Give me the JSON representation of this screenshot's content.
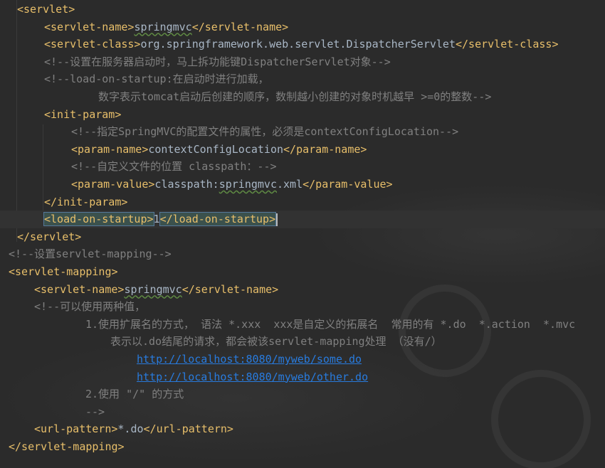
{
  "editor": {
    "lines": [
      {
        "segments": [
          {
            "text": "<servlet>",
            "kind": "tag"
          }
        ]
      },
      {
        "segments": [
          {
            "text": "<servlet-name>",
            "kind": "tag"
          },
          {
            "text": "springmvc",
            "kind": "text",
            "squiggle": true
          },
          {
            "text": "</servlet-name>",
            "kind": "tag"
          }
        ]
      },
      {
        "segments": [
          {
            "text": "<servlet-class>",
            "kind": "tag"
          },
          {
            "text": "org.springframework.web.servlet.DispatcherServlet",
            "kind": "text"
          },
          {
            "text": "</servlet-class>",
            "kind": "tag"
          }
        ]
      },
      {
        "segments": [
          {
            "text": "<!--设置在服务器启动时，马上拆功能键DispatcherServlet对象-->",
            "kind": "comment"
          }
        ]
      },
      {
        "segments": [
          {
            "text": "<!--load-on-startup:在启动时进行加载，",
            "kind": "comment"
          }
        ]
      },
      {
        "segments": [
          {
            "text": "数字表示tomcat启动后创建的顺序，数制越小创建的对象时机越早 >=0的整数-->",
            "kind": "comment"
          }
        ]
      },
      {
        "segments": [
          {
            "text": "<init-param>",
            "kind": "tag"
          }
        ]
      },
      {
        "segments": [
          {
            "text": "<!--指定SpringMVC的配置文件的属性，必须是contextConfigLocation-->",
            "kind": "comment"
          }
        ]
      },
      {
        "segments": [
          {
            "text": "<param-name>",
            "kind": "tag"
          },
          {
            "text": "contextConfigLocation",
            "kind": "text"
          },
          {
            "text": "</param-name>",
            "kind": "tag"
          }
        ]
      },
      {
        "segments": [
          {
            "text": "<!--自定义文件的位置 classpath：-->",
            "kind": "comment"
          }
        ]
      },
      {
        "segments": [
          {
            "text": "<param-value>",
            "kind": "tag"
          },
          {
            "text": "classpath:",
            "kind": "text"
          },
          {
            "text": "springmvc",
            "kind": "text",
            "squiggle": true
          },
          {
            "text": ".xml",
            "kind": "text"
          },
          {
            "text": "</param-value>",
            "kind": "tag"
          }
        ]
      },
      {
        "segments": [
          {
            "text": "</init-param>",
            "kind": "tag"
          }
        ]
      },
      {
        "segments": [
          {
            "text": "<load-on-startup>",
            "kind": "tag",
            "highlight": true
          },
          {
            "text": "1",
            "kind": "text"
          },
          {
            "text": "</load-on-startup>",
            "kind": "tag",
            "highlight": true
          }
        ],
        "current": true
      },
      {
        "segments": [
          {
            "text": "</servlet>",
            "kind": "tag"
          }
        ]
      },
      {
        "segments": [
          {
            "text": "<!--设置servlet-mapping-->",
            "kind": "comment"
          }
        ]
      },
      {
        "segments": [
          {
            "text": "<servlet-mapping>",
            "kind": "tag"
          }
        ]
      },
      {
        "segments": [
          {
            "text": "<servlet-name>",
            "kind": "tag"
          },
          {
            "text": "springmvc",
            "kind": "text",
            "squiggle": true
          },
          {
            "text": "</servlet-name>",
            "kind": "tag"
          }
        ]
      },
      {
        "segments": [
          {
            "text": "<!--可以使用两种值，",
            "kind": "comment"
          }
        ]
      },
      {
        "segments": [
          {
            "text": "1.使用扩展名的方式， 语法 *.xxx  xxx是自定义的拓展名  常用的有 *.do  *.action  *.mvc",
            "kind": "comment"
          }
        ]
      },
      {
        "segments": [
          {
            "text": "表示以.do结尾的请求，都会被该servlet-mapping处理 （没有/）",
            "kind": "comment"
          }
        ]
      },
      {
        "segments": [
          {
            "text": "http://localhost:8080/myweb/some.do",
            "kind": "link"
          }
        ]
      },
      {
        "segments": [
          {
            "text": "http://localhost:8080/myweb/other.do",
            "kind": "link"
          }
        ]
      },
      {
        "segments": [
          {
            "text": "2.使用 \"/\" 的方式",
            "kind": "comment"
          }
        ]
      },
      {
        "segments": [
          {
            "text": "-->",
            "kind": "comment"
          }
        ]
      },
      {
        "segments": [
          {
            "text": "<url-pattern>",
            "kind": "tag"
          },
          {
            "text": "*.do",
            "kind": "text"
          },
          {
            "text": "</url-pattern>",
            "kind": "tag"
          }
        ]
      },
      {
        "segments": [
          {
            "text": "</servlet-mapping>",
            "kind": "tag"
          }
        ]
      }
    ]
  },
  "colors": {
    "background": "#2b2b2b",
    "tag": "#e8bf6a",
    "comment": "#808080",
    "text": "#a9b7c6",
    "link": "#287bde",
    "current_line": "#323232"
  }
}
